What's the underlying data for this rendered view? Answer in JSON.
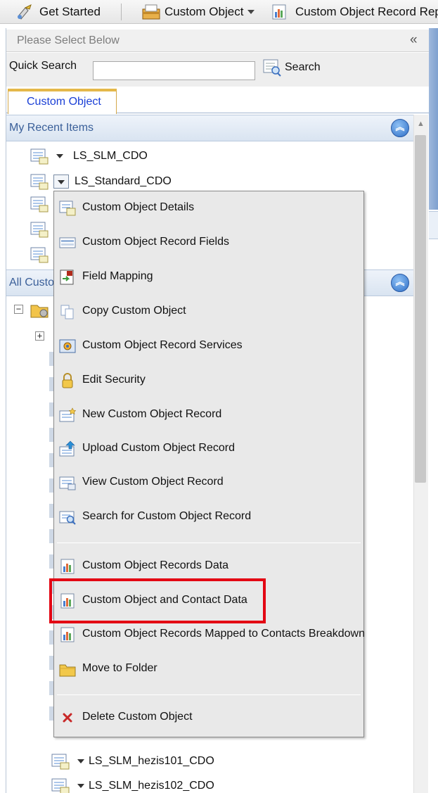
{
  "toolbar": {
    "get_started": "Get Started",
    "custom_object": "Custom Object",
    "custom_object_record_reports": "Custom Object Record Repo"
  },
  "panel": {
    "header": "Please Select Below",
    "collapse_glyph": "«",
    "quick_search_label": "Quick Search",
    "quick_search_value": "",
    "search_button": "Search",
    "tab": "Custom Object"
  },
  "recent": {
    "header": "My Recent Items",
    "items": [
      {
        "label": "LS_SLM_CDO"
      },
      {
        "label": "LS_Standard_CDO"
      }
    ]
  },
  "all": {
    "header": "All Custo",
    "bottom_items": [
      {
        "label": "LS_SLM_hezis101_CDO"
      },
      {
        "label": "LS_SLM_hezis102_CDO"
      }
    ]
  },
  "context_menu": {
    "items": [
      {
        "label": "Custom Object Details",
        "icon": "record-detail-icon"
      },
      {
        "label": "Custom Object Record Fields",
        "icon": "fields-icon"
      },
      {
        "label": "Field Mapping",
        "icon": "field-mapping-icon"
      },
      {
        "label": "Copy Custom Object",
        "icon": "copy-icon"
      },
      {
        "label": "Custom Object Record Services",
        "icon": "services-icon"
      },
      {
        "label": "Edit Security",
        "icon": "lock-icon"
      },
      {
        "label": "New Custom Object Record",
        "icon": "new-record-icon"
      },
      {
        "label": "Upload Custom Object Record",
        "icon": "upload-icon"
      },
      {
        "label": "View Custom Object Record",
        "icon": "view-record-icon"
      },
      {
        "label": "Search for Custom Object Record",
        "icon": "search-record-icon"
      },
      {
        "label": "Custom Object Records Data",
        "icon": "report-icon"
      },
      {
        "label": "Custom Object and Contact Data",
        "icon": "report-icon"
      },
      {
        "label": "Custom Object Records Mapped to Contacts Breakdown",
        "icon": "report-icon"
      },
      {
        "label": "Move to Folder",
        "icon": "folder-icon"
      },
      {
        "label": "Delete Custom Object",
        "icon": "delete-icon"
      }
    ],
    "highlighted_index": 11
  },
  "colors": {
    "highlight": "#e30613",
    "tab_text": "#1a3fd6",
    "section_text": "#3a5f99"
  }
}
